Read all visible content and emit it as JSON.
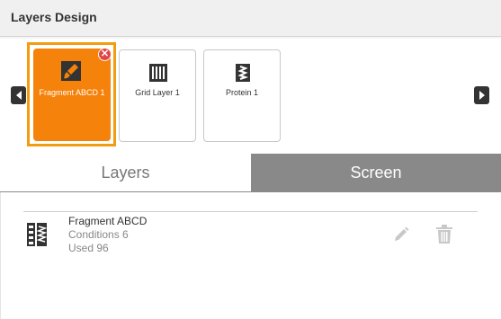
{
  "header": {
    "title": "Layers Design"
  },
  "carousel": {
    "cards": [
      {
        "label": "Fragment ABCD 1",
        "icon": "brush-icon",
        "selected": true
      },
      {
        "label": "Grid Layer 1",
        "icon": "grid-icon",
        "selected": false
      },
      {
        "label": "Protein 1",
        "icon": "protein-icon",
        "selected": false
      }
    ],
    "close_symbol": "✕",
    "prev_icon": "caret-left-icon",
    "next_icon": "caret-right-icon"
  },
  "tabs": [
    {
      "label": "Layers",
      "active": false
    },
    {
      "label": "Screen",
      "active": true
    }
  ],
  "list": {
    "items": [
      {
        "title": "Fragment ABCD",
        "conditions": "Conditions 6",
        "used": "Used 96",
        "icon": "fragment-icon",
        "edit_icon": "pencil-icon",
        "delete_icon": "trash-icon"
      }
    ]
  },
  "colors": {
    "accent": "#f5820a",
    "selection_border": "#f39c12",
    "close_badge": "#e04848",
    "active_tab": "#898989"
  }
}
